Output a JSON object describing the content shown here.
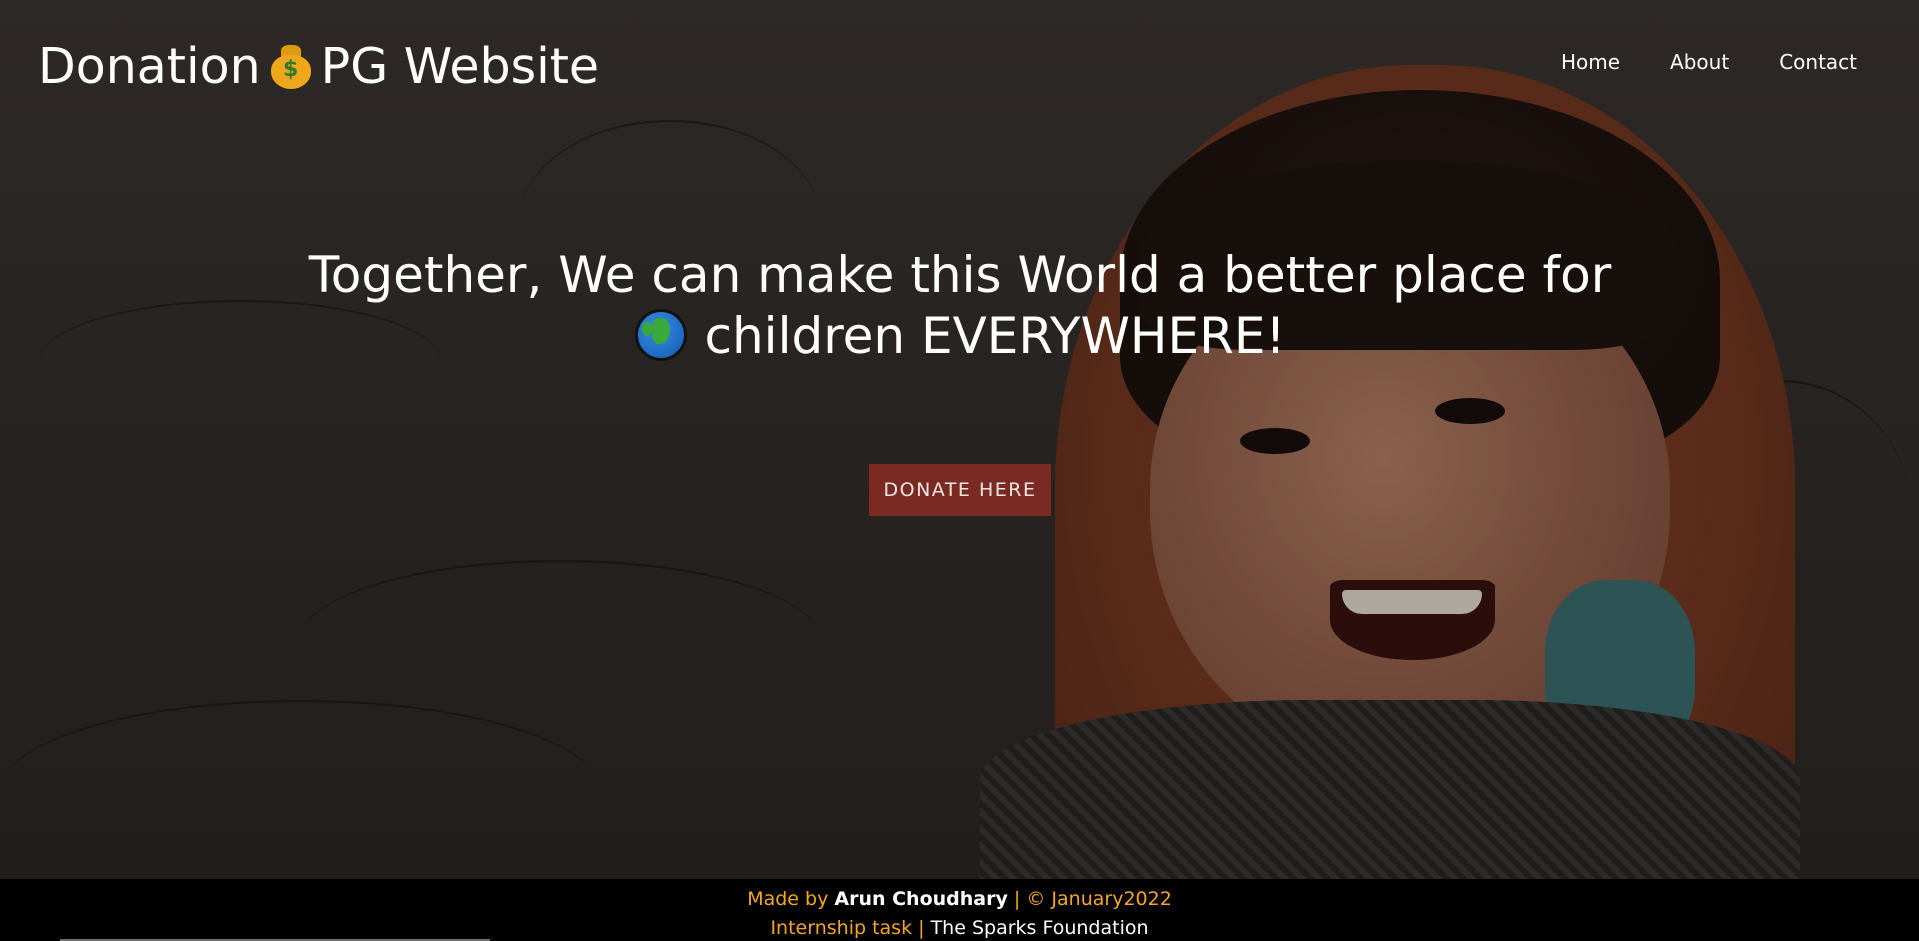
{
  "header": {
    "brand_prefix": "Donation",
    "brand_icon": "money-bag-icon",
    "brand_suffix": "PG Website",
    "nav": [
      {
        "label": "Home"
      },
      {
        "label": "About"
      },
      {
        "label": "Contact"
      }
    ]
  },
  "hero": {
    "headline_line1": "Together, We can make this World a better place for",
    "headline_icon": "globe-icon",
    "headline_line2": "children EVERYWHERE!",
    "cta_label": "DONATE HERE"
  },
  "footer": {
    "made_by_prefix": "Made by",
    "author": "Arun Choudhary",
    "separator1": "|",
    "copyright": "© January2022",
    "internship": "Internship task",
    "separator2": "|",
    "organization": "The Sparks Foundation"
  },
  "colors": {
    "accent_button": "#7a2a22",
    "footer_text": "#f5a623",
    "footer_bg": "#000000"
  }
}
